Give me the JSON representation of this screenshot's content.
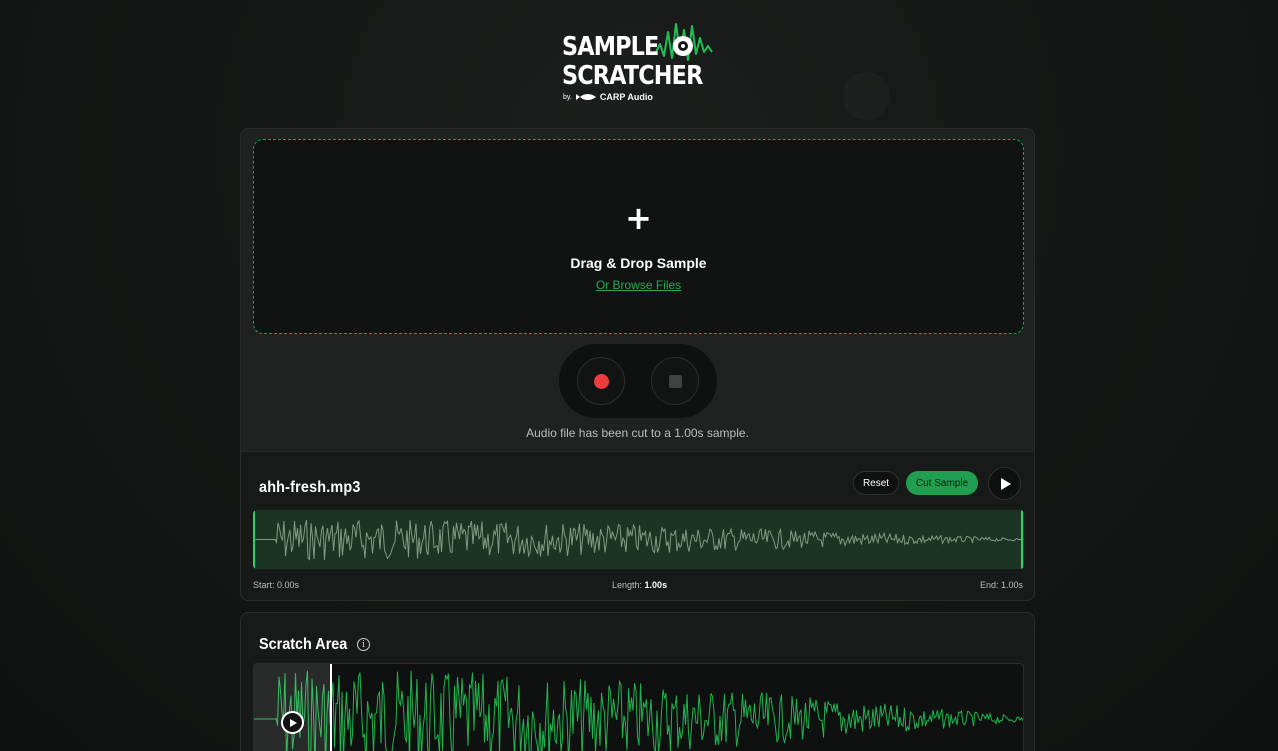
{
  "brand": {
    "title_line1": "SAMPLE",
    "title_line2": "SCRATCHER",
    "by_prefix": "by.",
    "company": "CARP Audio",
    "icons": [
      "record-icon",
      "sound-waves-icon",
      "fish-icon"
    ]
  },
  "upload": {
    "plus_symbol": "+",
    "title": "Drag & Drop Sample",
    "browse_link": "Or Browse Files"
  },
  "recorder": {
    "status": "Audio file has been cut to a 1.00s sample.",
    "icons": [
      "record-icon",
      "stop-icon"
    ]
  },
  "sample": {
    "file_name": "ahh-fresh.mp3",
    "reset_label": "Reset",
    "cut_label": "Cut Sample",
    "start_label": "Start: 0.00s",
    "length_prefix": "Length:",
    "length_value": "1.00s",
    "end_label": "End: 1.00s"
  },
  "scratch": {
    "title": "Scratch Area",
    "info_symbol": "i"
  },
  "colors": {
    "accent": "#1f9f4f",
    "record": "#ef3d3d",
    "background": "#141615"
  }
}
